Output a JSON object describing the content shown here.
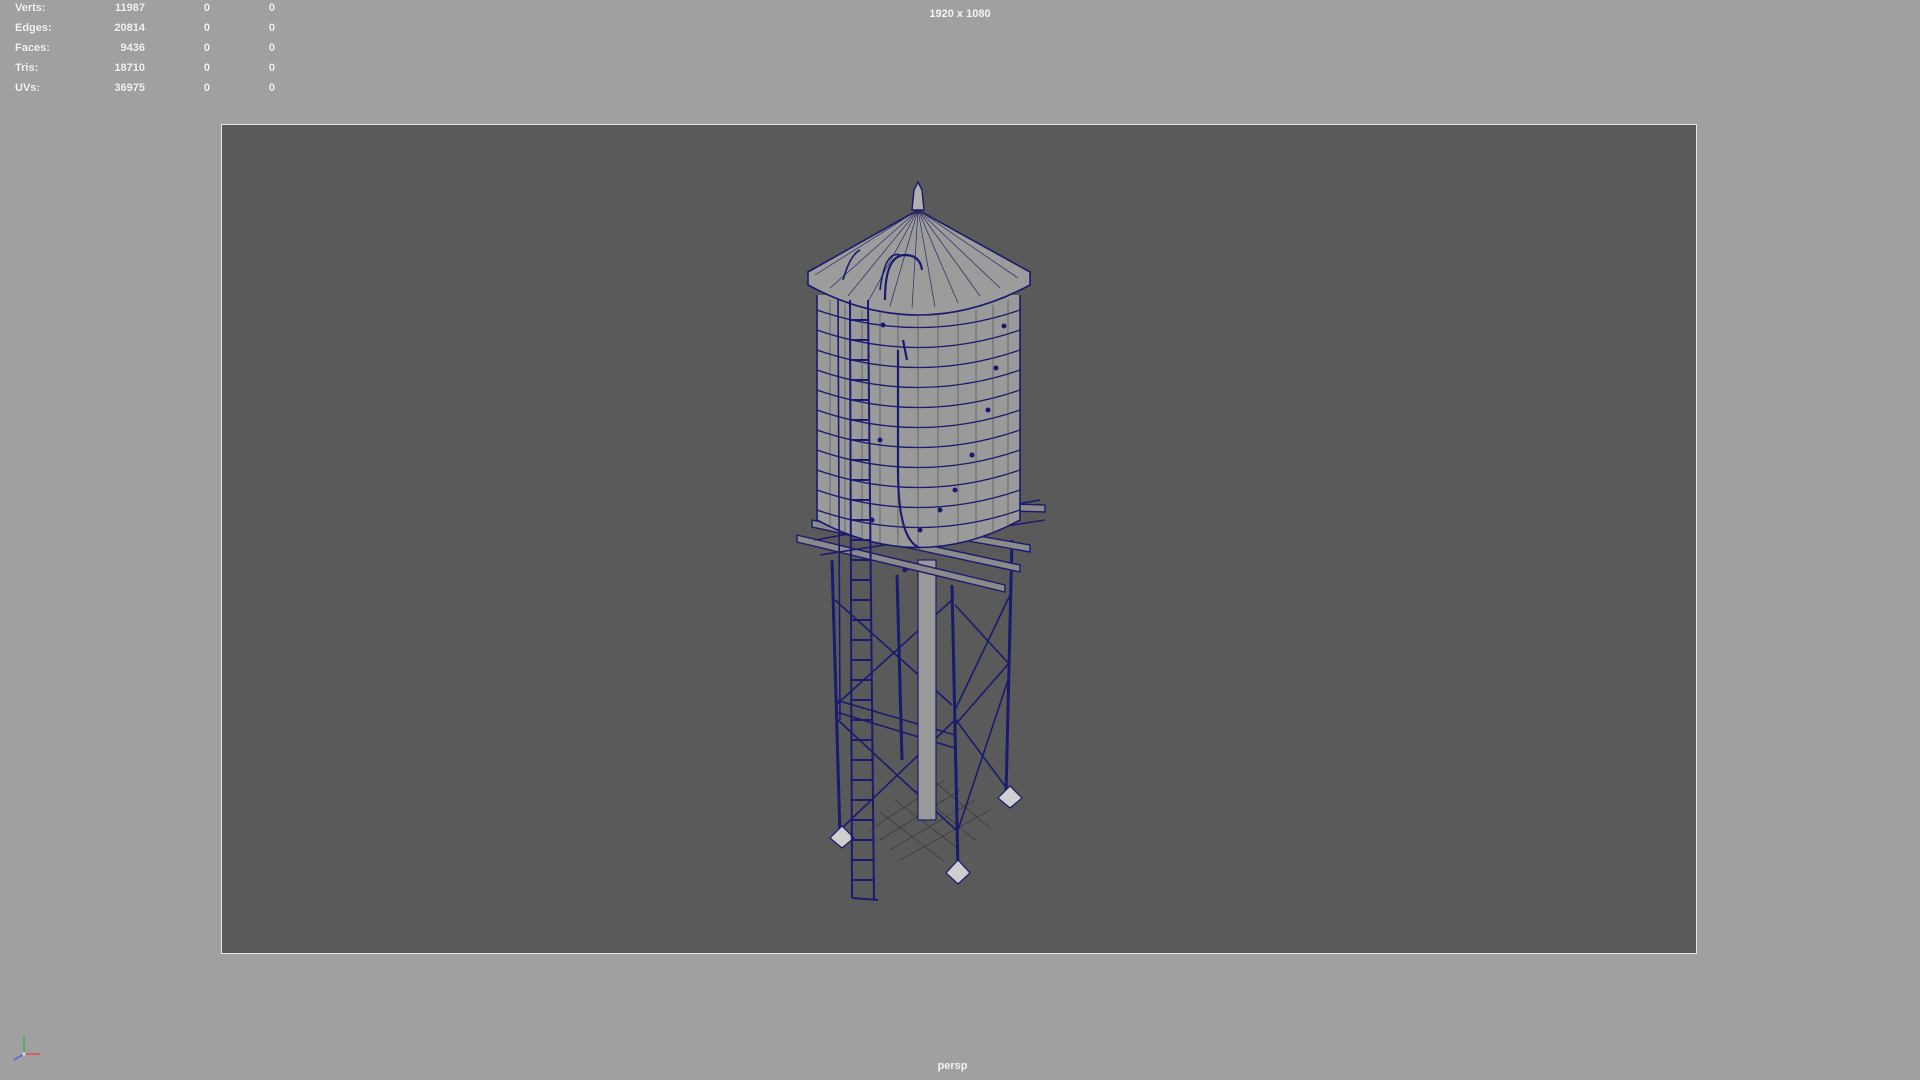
{
  "hud": {
    "rows": [
      {
        "label": "Verts:",
        "value": "11987",
        "selected": "0",
        "components": "0"
      },
      {
        "label": "Edges:",
        "value": "20814",
        "selected": "0",
        "components": "0"
      },
      {
        "label": "Faces:",
        "value": "9436",
        "selected": "0",
        "components": "0"
      },
      {
        "label": "Tris:",
        "value": "18710",
        "selected": "0",
        "components": "0"
      },
      {
        "label": "UVs:",
        "value": "36975",
        "selected": "0",
        "components": "0"
      }
    ]
  },
  "viewport": {
    "resolution_label": "1920 x 1080",
    "camera_name": "persp",
    "background_color": "#5a5a5a",
    "surround_color": "#a0a0a0",
    "wireframe_color": "#1a1a6e",
    "shaded_color": "#9a9a9a"
  },
  "icons": {
    "axis": "xyz-axis-indicator-icon"
  }
}
